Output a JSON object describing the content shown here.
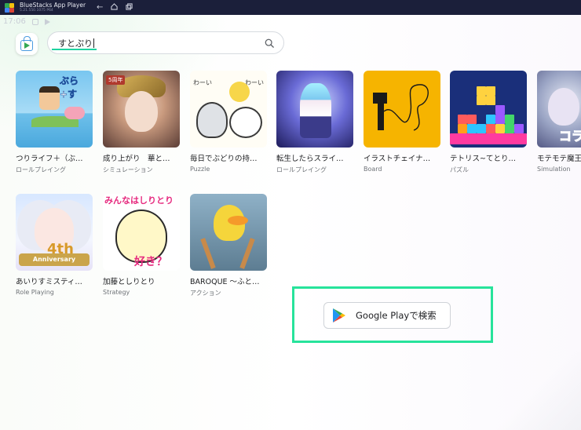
{
  "window": {
    "title": "BlueStacks App Player",
    "subtitle": "5.21.550.1075  P64"
  },
  "status": {
    "time": "17:06"
  },
  "search": {
    "value": "すとぷり"
  },
  "apps": [
    {
      "name": "つりライフ＋（ぶ…",
      "category": "ロールプレイング"
    },
    {
      "name": "成り上がり　華と…",
      "category": "シミュレーション"
    },
    {
      "name": "毎日でぶどりの持…",
      "category": "Puzzle"
    },
    {
      "name": "転生したらスライ…",
      "category": "ロールプレイング"
    },
    {
      "name": "イラストチェイナ…",
      "category": "Board"
    },
    {
      "name": "テトリス~てとり…",
      "category": "パズル"
    },
    {
      "name": "モテモテ魔王",
      "category": "Simulation"
    },
    {
      "name": "あいりすミスティ…",
      "category": "Role Playing"
    },
    {
      "name": "加藤としりとり",
      "category": "Strategy"
    },
    {
      "name": "BAROQUE ～ふと…",
      "category": "アクション"
    }
  ],
  "thumb_text": {
    "app1_tag": "ぶら+す",
    "app2_ribbon": "5周年",
    "app3_w1": "わーい",
    "app3_w2": "わーい",
    "app7_kana": "コラ",
    "app8_num": "4th",
    "app8_anniv": "Anniversary",
    "app9_top": "みんなはしりとり",
    "app9_like": "好き？"
  },
  "google_play": {
    "label": "Google Playで検索"
  },
  "colors": {
    "titlebar": "#1b1f3a",
    "accent_underline": "#1fd3a0",
    "highlight": "#27e39b"
  }
}
